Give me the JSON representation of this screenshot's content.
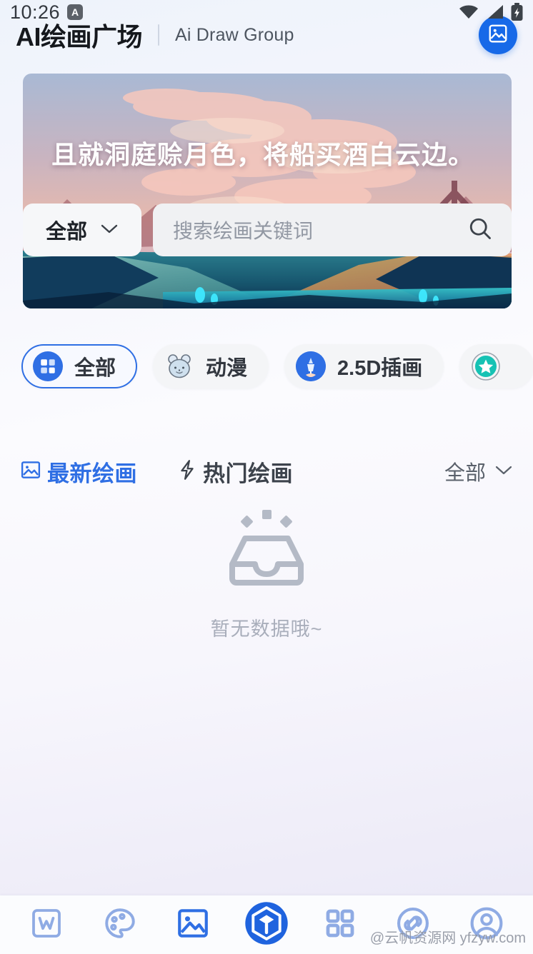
{
  "status_bar": {
    "time": "10:26",
    "badge": "A",
    "icons": [
      "wifi-icon",
      "signal-icon",
      "battery-charging-icon"
    ]
  },
  "header": {
    "title": "AI绘画广场",
    "subtitle": "Ai Draw Group",
    "action_icon": "image-icon"
  },
  "banner": {
    "poem": "且就洞庭赊月色，将船买酒白云边。"
  },
  "search": {
    "category_label": "全部",
    "category_chevron": "chevron-down-icon",
    "placeholder": "搜索绘画关键词",
    "search_icon": "search-icon"
  },
  "categories": [
    {
      "label": "全部",
      "icon": "grid-squares-icon",
      "active": true
    },
    {
      "label": "动漫",
      "icon": "cat-face-icon",
      "active": false
    },
    {
      "label": "2.5D插画",
      "icon": "paint-drop-icon",
      "active": false
    },
    {
      "label": "",
      "icon": "star-circle-icon",
      "active": false
    }
  ],
  "tabs": [
    {
      "label": "最新绘画",
      "icon": "picture-icon",
      "active": true
    },
    {
      "label": "热门绘画",
      "icon": "lightning-icon",
      "active": false
    }
  ],
  "tab_filter": {
    "label": "全部",
    "icon": "chevron-down-icon"
  },
  "empty_state": {
    "icon": "empty-inbox-icon",
    "text": "暂无数据哦~"
  },
  "bottom_nav": [
    {
      "name": "word-doc",
      "icon": "w-square-icon",
      "active": false
    },
    {
      "name": "palette",
      "icon": "palette-icon",
      "active": false
    },
    {
      "name": "image",
      "icon": "image-frame-icon",
      "active": false
    },
    {
      "name": "cube",
      "icon": "cube-hexagon-icon",
      "active": true
    },
    {
      "name": "grid",
      "icon": "grid-four-icon",
      "active": false
    },
    {
      "name": "link",
      "icon": "link-circle-icon",
      "active": false
    },
    {
      "name": "profile",
      "icon": "user-circle-icon",
      "active": false
    }
  ],
  "watermark": "@云帆资源网 yfzyw.com",
  "colors": {
    "accent": "#2f6fe4",
    "accent_deep": "#1769e8",
    "nav_inactive": "#8fabe4",
    "text_primary": "#15181d",
    "text_muted": "#9298a3",
    "teal": "#16c2b4"
  }
}
